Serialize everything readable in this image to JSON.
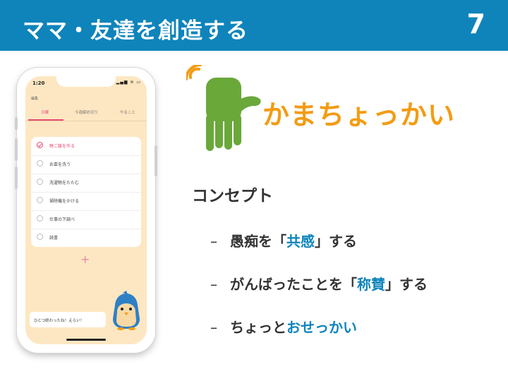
{
  "slide": {
    "title": "ママ・友達を創造する",
    "page_number": "7",
    "colors": {
      "header": "#0e84bb",
      "accent": "#0e84bb",
      "logo_orange": "#f29c14",
      "logo_green": "#6aa83a"
    }
  },
  "phone": {
    "status": {
      "time": "1:20",
      "icons": "▂▄▆ ≋ ▭"
    },
    "top_label": "編集",
    "tabs": [
      {
        "label": "日課",
        "active": true
      },
      {
        "label": "今週締め切り",
        "active": false
      },
      {
        "label": "やること",
        "active": false
      }
    ],
    "tasks": [
      {
        "label": "晩ご飯を作る",
        "done": true
      },
      {
        "label": "お皿を洗う",
        "done": false
      },
      {
        "label": "洗濯物をたたむ",
        "done": false
      },
      {
        "label": "掃除機をかける",
        "done": false
      },
      {
        "label": "仕事の下調べ",
        "done": false
      },
      {
        "label": "読書",
        "done": false
      }
    ],
    "add_symbol": "+",
    "speech": "ひとつ終わったね！えらい！"
  },
  "logo": {
    "text": "かまちょっかい",
    "icon": "hand-logo-icon"
  },
  "concept": {
    "title": "コンセプト",
    "bullets": [
      {
        "dash": "–",
        "pre": "愚痴を「",
        "highlight": "共感",
        "post": "」する"
      },
      {
        "dash": "–",
        "pre": "がんばったことを「",
        "highlight": "称賛",
        "post": "」する"
      },
      {
        "dash": "–",
        "pre": "ちょっと",
        "highlight": "おせっかい",
        "post": ""
      }
    ]
  }
}
